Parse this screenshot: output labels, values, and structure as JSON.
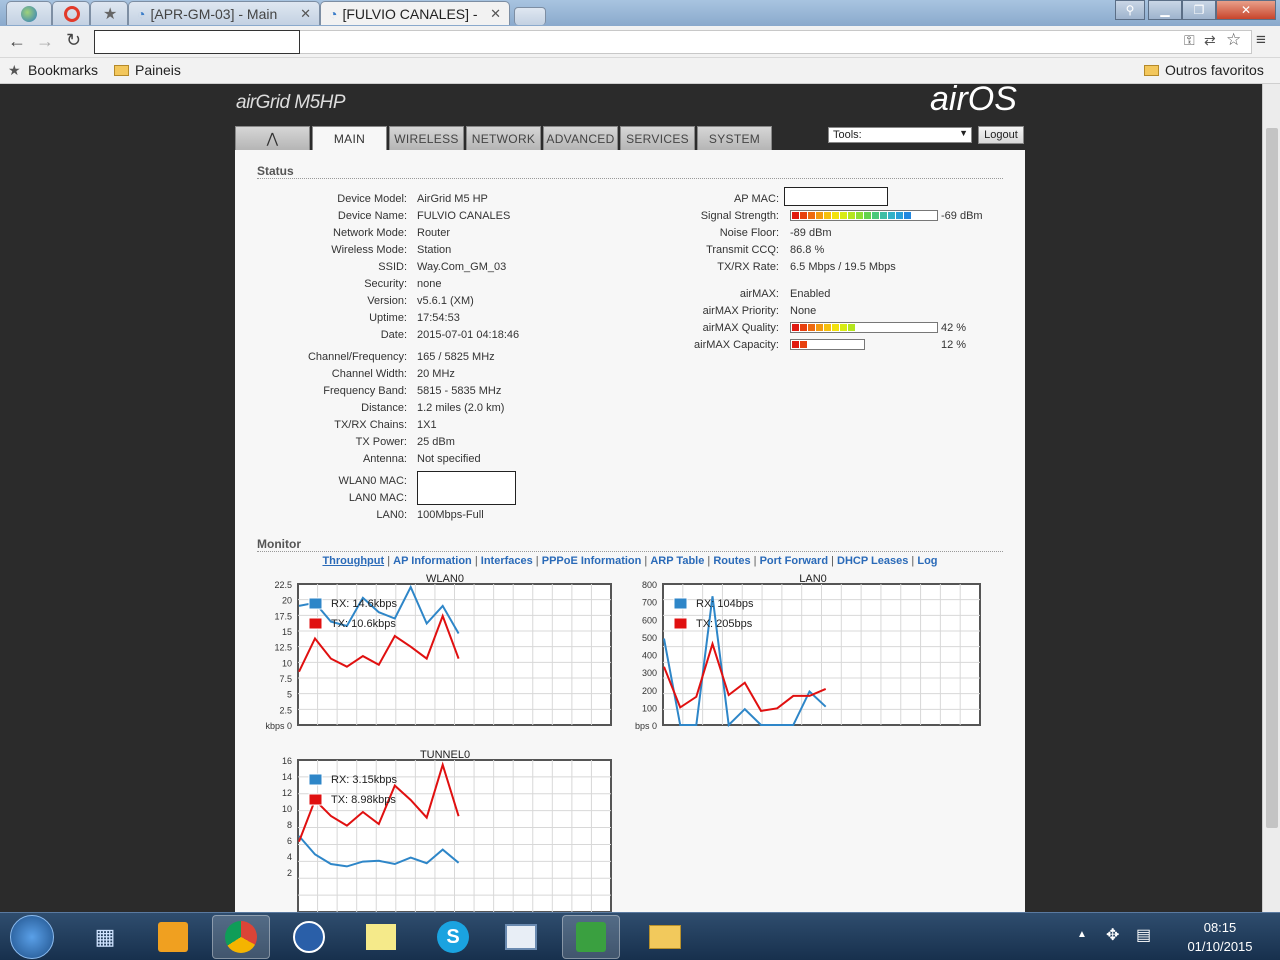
{
  "browser": {
    "tabs": [
      {
        "label": ""
      },
      {
        "label": ""
      },
      {
        "label": ""
      },
      {
        "label": "[APR-GM-03] - Main"
      },
      {
        "label": "[FULVIO CANALES] -"
      }
    ],
    "address": "",
    "bookmarks_label": "Bookmarks",
    "bookmark_folder": "Paineis",
    "other_bookmarks": "Outros favoritos"
  },
  "device": {
    "logo_left": "airGrid M5HP",
    "logo_right": "airOS",
    "nav": [
      "MAIN",
      "WIRELESS",
      "NETWORK",
      "ADVANCED",
      "SERVICES",
      "SYSTEM"
    ],
    "tools_label": "Tools:",
    "logout_label": "Logout"
  },
  "status": {
    "title": "Status",
    "left": [
      {
        "label": "Device Model:",
        "value": "AirGrid M5 HP"
      },
      {
        "label": "Device Name:",
        "value": "FULVIO CANALES"
      },
      {
        "label": "Network Mode:",
        "value": "Router"
      },
      {
        "label": "Wireless Mode:",
        "value": "Station"
      },
      {
        "label": "SSID:",
        "value": "Way.Com_GM_03"
      },
      {
        "label": "Security:",
        "value": "none"
      },
      {
        "label": "Version:",
        "value": "v5.6.1 (XM)"
      },
      {
        "label": "Uptime:",
        "value": "17:54:53"
      },
      {
        "label": "Date:",
        "value": "2015-07-01 04:18:46"
      }
    ],
    "left2": [
      {
        "label": "Channel/Frequency:",
        "value": "165 / 5825 MHz"
      },
      {
        "label": "Channel Width:",
        "value": "20 MHz"
      },
      {
        "label": "Frequency Band:",
        "value": "5815 - 5835 MHz"
      },
      {
        "label": "Distance:",
        "value": "1.2 miles (2.0 km)"
      },
      {
        "label": "TX/RX Chains:",
        "value": "1X1"
      },
      {
        "label": "TX Power:",
        "value": "25 dBm"
      },
      {
        "label": "Antenna:",
        "value": "Not specified"
      }
    ],
    "wlan_mac_label": "WLAN0 MAC:",
    "lan_mac_label": "LAN0 MAC:",
    "lan_label": "LAN0:",
    "lan_value": "100Mbps-Full",
    "ap_mac_label": "AP MAC:",
    "signal_label": "Signal Strength:",
    "signal_value": "-69 dBm",
    "signal_fraction": 0.82,
    "noise_label": "Noise Floor:",
    "noise_value": "-89 dBm",
    "ccq_label": "Transmit CCQ:",
    "ccq_value": "86.8 %",
    "rate_label": "TX/RX Rate:",
    "rate_value": "6.5 Mbps / 19.5 Mbps",
    "airmax_label": "airMAX:",
    "airmax_value": "Enabled",
    "priority_label": "airMAX Priority:",
    "priority_value": "None",
    "quality_label": "airMAX Quality:",
    "quality_value": "42 %",
    "quality_fraction": 0.42,
    "capacity_label": "airMAX Capacity:",
    "capacity_value": "12 %",
    "capacity_fraction": 0.12
  },
  "monitor": {
    "title": "Monitor",
    "links": [
      "Throughput",
      "AP Information",
      "Interfaces",
      "PPPoE Information",
      "ARP Table",
      "Routes",
      "Port Forward",
      "DHCP Leases",
      "Log"
    ]
  },
  "chart_data": [
    {
      "type": "line",
      "title": "WLAN0",
      "ylabel": "kbps",
      "ylim": [
        0,
        22.5
      ],
      "yticks": [
        "22.5",
        "20",
        "17.5",
        "15",
        "12.5",
        "10",
        "7.5",
        "5",
        "2.5",
        "kbps 0"
      ],
      "series": [
        {
          "name": "RX: 14.6kbps",
          "color": "#2e86c8",
          "values": [
            19,
            19.5,
            16.5,
            15.8,
            20.3,
            18,
            17,
            22,
            16.2,
            19,
            14.6
          ]
        },
        {
          "name": "TX: 10.6kbps",
          "color": "#e01010",
          "values": [
            8.5,
            13.8,
            10.6,
            9.3,
            11,
            9.6,
            14.2,
            12.5,
            10.6,
            17.4,
            10.6
          ]
        }
      ]
    },
    {
      "type": "line",
      "title": "LAN0",
      "ylabel": "bps",
      "ylim": [
        0,
        800
      ],
      "yticks": [
        "800",
        "700",
        "600",
        "500",
        "400",
        "300",
        "200",
        "100",
        "bps 0"
      ],
      "series": [
        {
          "name": "RX: 104bps",
          "color": "#2e86c8",
          "values": [
            490,
            0,
            0,
            730,
            0,
            90,
            0,
            0,
            0,
            190,
            104
          ]
        },
        {
          "name": "TX: 205bps",
          "color": "#e01010",
          "values": [
            330,
            100,
            160,
            460,
            170,
            240,
            80,
            95,
            165,
            165,
            205
          ]
        }
      ]
    },
    {
      "type": "line",
      "title": "TUNNEL0",
      "ylabel": "",
      "ylim": [
        0,
        16
      ],
      "yticks": [
        "16",
        "14",
        "12",
        "10",
        "8",
        "6",
        "4",
        "2"
      ],
      "series": [
        {
          "name": "RX: 3.15kbps",
          "color": "#2e86c8",
          "values": [
            6.5,
            4.2,
            3.0,
            2.7,
            3.3,
            3.4,
            3.0,
            3.8,
            3.1,
            4.8,
            3.15
          ]
        },
        {
          "name": "TX: 8.98kbps",
          "color": "#e01010",
          "values": [
            5.8,
            11,
            9,
            7.8,
            9.5,
            8,
            12.8,
            11,
            8.8,
            15.4,
            8.98
          ]
        }
      ]
    }
  ],
  "taskbar": {
    "time": "08:15",
    "date": "01/10/2015"
  }
}
